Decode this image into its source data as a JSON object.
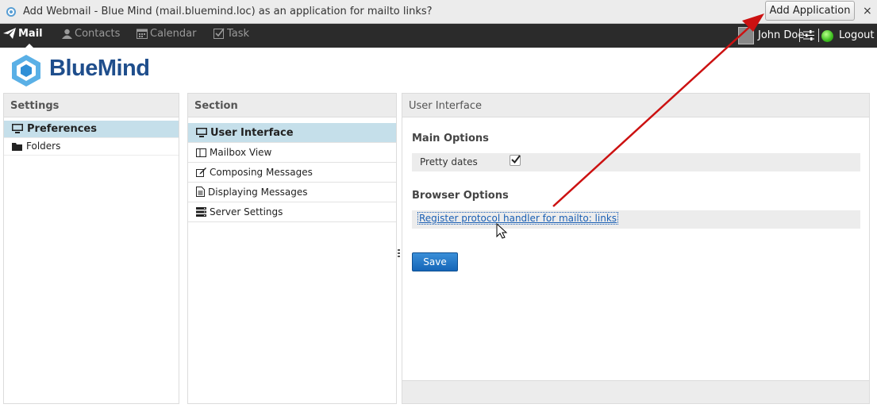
{
  "notification": {
    "message": "Add Webmail - Blue Mind (mail.bluemind.loc) as an application for mailto links?",
    "button_label": "Add Application",
    "close_glyph": "×",
    "icon": "app-icon"
  },
  "nav": {
    "items": [
      {
        "label": "Mail",
        "icon": "paper-plane-icon",
        "active": true
      },
      {
        "label": "Contacts",
        "icon": "person-icon",
        "active": false
      },
      {
        "label": "Calendar",
        "icon": "calendar-icon",
        "active": false
      },
      {
        "label": "Task",
        "icon": "checkbox-icon",
        "active": false
      }
    ],
    "user_name": "John Doe",
    "logout_label": "Logout",
    "status_color": "#3bbd1e"
  },
  "logo": {
    "text": "BlueMind",
    "color": "#1f4e8c"
  },
  "settings": {
    "title": "Settings",
    "items": [
      {
        "label": "Preferences",
        "icon": "monitor-icon",
        "selected": true
      },
      {
        "label": "Folders",
        "icon": "folder-icon",
        "selected": false
      }
    ]
  },
  "section": {
    "title": "Section",
    "items": [
      {
        "label": "User Interface",
        "icon": "monitor-icon",
        "selected": true
      },
      {
        "label": "Mailbox View",
        "icon": "columns-icon",
        "selected": false
      },
      {
        "label": "Composing Messages",
        "icon": "edit-icon",
        "selected": false
      },
      {
        "label": "Displaying Messages",
        "icon": "document-icon",
        "selected": false
      },
      {
        "label": "Server Settings",
        "icon": "server-icon",
        "selected": false
      }
    ]
  },
  "user_interface": {
    "title": "User Interface",
    "main_options_heading": "Main Options",
    "pretty_dates_label": "Pretty dates",
    "pretty_dates_checked": true,
    "browser_options_heading": "Browser Options",
    "register_link": "Register protocol handler for mailto: links",
    "save_label": "Save"
  },
  "colors": {
    "selection": "#c5dfea",
    "save_button": "#1565b8",
    "annotation_arrow": "#cc1111"
  }
}
